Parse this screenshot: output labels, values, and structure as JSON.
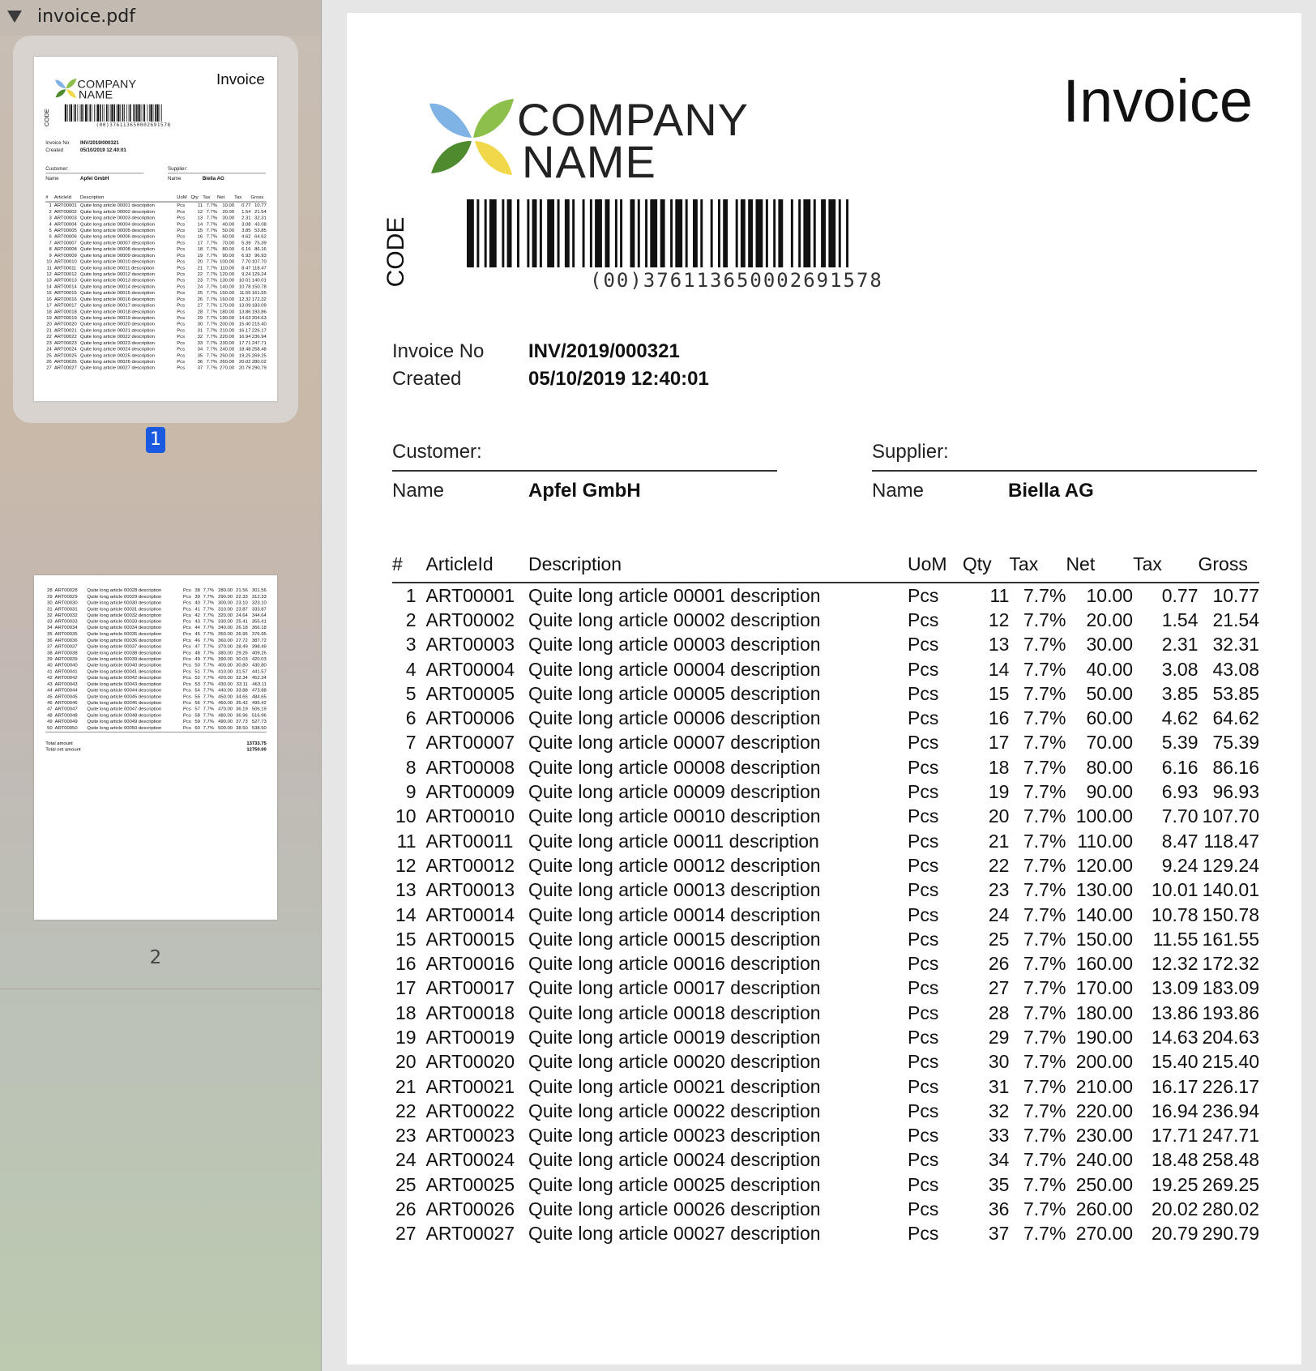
{
  "sidebar": {
    "file_name": "invoice.pdf",
    "pages": [
      {
        "number": "1",
        "selected": true
      },
      {
        "number": "2",
        "selected": false
      }
    ]
  },
  "invoice": {
    "company_line1": "COMPANY",
    "company_line2": "NAME",
    "title": "Invoice",
    "code_label": "CODE",
    "barcode_text": "(00)376113650002691578",
    "invoice_no_label": "Invoice No",
    "invoice_no": "INV/2019/000321",
    "created_label": "Created",
    "created": "05/10/2019 12:40:01",
    "customer_heading": "Customer:",
    "supplier_heading": "Supplier:",
    "name_label": "Name",
    "customer_name": "Apfel GmbH",
    "supplier_name": "Biella AG",
    "columns": [
      "#",
      "ArticleId",
      "Description",
      "UoM",
      "Qty",
      "Tax",
      "Net",
      "Tax",
      "Gross"
    ],
    "rows": [
      [
        "1",
        "ART00001",
        "Quite long article 00001 description",
        "Pcs",
        "11",
        "7.7%",
        "10.00",
        "0.77",
        "10.77"
      ],
      [
        "2",
        "ART00002",
        "Quite long article 00002 description",
        "Pcs",
        "12",
        "7.7%",
        "20.00",
        "1.54",
        "21.54"
      ],
      [
        "3",
        "ART00003",
        "Quite long article 00003 description",
        "Pcs",
        "13",
        "7.7%",
        "30.00",
        "2.31",
        "32.31"
      ],
      [
        "4",
        "ART00004",
        "Quite long article 00004 description",
        "Pcs",
        "14",
        "7.7%",
        "40.00",
        "3.08",
        "43.08"
      ],
      [
        "5",
        "ART00005",
        "Quite long article 00005 description",
        "Pcs",
        "15",
        "7.7%",
        "50.00",
        "3.85",
        "53.85"
      ],
      [
        "6",
        "ART00006",
        "Quite long article 00006 description",
        "Pcs",
        "16",
        "7.7%",
        "60.00",
        "4.62",
        "64.62"
      ],
      [
        "7",
        "ART00007",
        "Quite long article 00007 description",
        "Pcs",
        "17",
        "7.7%",
        "70.00",
        "5.39",
        "75.39"
      ],
      [
        "8",
        "ART00008",
        "Quite long article 00008 description",
        "Pcs",
        "18",
        "7.7%",
        "80.00",
        "6.16",
        "86.16"
      ],
      [
        "9",
        "ART00009",
        "Quite long article 00009 description",
        "Pcs",
        "19",
        "7.7%",
        "90.00",
        "6.93",
        "96.93"
      ],
      [
        "10",
        "ART00010",
        "Quite long article 00010 description",
        "Pcs",
        "20",
        "7.7%",
        "100.00",
        "7.70",
        "107.70"
      ],
      [
        "11",
        "ART00011",
        "Quite long article 00011 description",
        "Pcs",
        "21",
        "7.7%",
        "110.00",
        "8.47",
        "118.47"
      ],
      [
        "12",
        "ART00012",
        "Quite long article 00012 description",
        "Pcs",
        "22",
        "7.7%",
        "120.00",
        "9.24",
        "129.24"
      ],
      [
        "13",
        "ART00013",
        "Quite long article 00013 description",
        "Pcs",
        "23",
        "7.7%",
        "130.00",
        "10.01",
        "140.01"
      ],
      [
        "14",
        "ART00014",
        "Quite long article 00014 description",
        "Pcs",
        "24",
        "7.7%",
        "140.00",
        "10.78",
        "150.78"
      ],
      [
        "15",
        "ART00015",
        "Quite long article 00015 description",
        "Pcs",
        "25",
        "7.7%",
        "150.00",
        "11.55",
        "161.55"
      ],
      [
        "16",
        "ART00016",
        "Quite long article 00016 description",
        "Pcs",
        "26",
        "7.7%",
        "160.00",
        "12.32",
        "172.32"
      ],
      [
        "17",
        "ART00017",
        "Quite long article 00017 description",
        "Pcs",
        "27",
        "7.7%",
        "170.00",
        "13.09",
        "183.09"
      ],
      [
        "18",
        "ART00018",
        "Quite long article 00018 description",
        "Pcs",
        "28",
        "7.7%",
        "180.00",
        "13.86",
        "193.86"
      ],
      [
        "19",
        "ART00019",
        "Quite long article 00019 description",
        "Pcs",
        "29",
        "7.7%",
        "190.00",
        "14.63",
        "204.63"
      ],
      [
        "20",
        "ART00020",
        "Quite long article 00020 description",
        "Pcs",
        "30",
        "7.7%",
        "200.00",
        "15.40",
        "215.40"
      ],
      [
        "21",
        "ART00021",
        "Quite long article 00021 description",
        "Pcs",
        "31",
        "7.7%",
        "210.00",
        "16.17",
        "226.17"
      ],
      [
        "22",
        "ART00022",
        "Quite long article 00022 description",
        "Pcs",
        "32",
        "7.7%",
        "220.00",
        "16.94",
        "236.94"
      ],
      [
        "23",
        "ART00023",
        "Quite long article 00023 description",
        "Pcs",
        "33",
        "7.7%",
        "230.00",
        "17.71",
        "247.71"
      ],
      [
        "24",
        "ART00024",
        "Quite long article 00024 description",
        "Pcs",
        "34",
        "7.7%",
        "240.00",
        "18.48",
        "258.48"
      ],
      [
        "25",
        "ART00025",
        "Quite long article 00025 description",
        "Pcs",
        "35",
        "7.7%",
        "250.00",
        "19.25",
        "269.25"
      ],
      [
        "26",
        "ART00026",
        "Quite long article 00026 description",
        "Pcs",
        "36",
        "7.7%",
        "260.00",
        "20.02",
        "280.02"
      ],
      [
        "27",
        "ART00027",
        "Quite long article 00027 description",
        "Pcs",
        "37",
        "7.7%",
        "270.00",
        "20.79",
        "290.79"
      ]
    ],
    "page2_rows": [
      [
        "28",
        "ART00028",
        "Quite long article 00028 description",
        "Pcs",
        "38",
        "7.7%",
        "280.00",
        "21.56",
        "301.56"
      ],
      [
        "29",
        "ART00029",
        "Quite long article 00029 description",
        "Pcs",
        "39",
        "7.7%",
        "290.00",
        "22.33",
        "312.33"
      ],
      [
        "30",
        "ART00030",
        "Quite long article 00030 description",
        "Pcs",
        "40",
        "7.7%",
        "300.00",
        "23.10",
        "323.10"
      ],
      [
        "31",
        "ART00031",
        "Quite long article 00031 description",
        "Pcs",
        "41",
        "7.7%",
        "310.00",
        "23.87",
        "333.87"
      ],
      [
        "32",
        "ART00032",
        "Quite long article 00032 description",
        "Pcs",
        "42",
        "7.7%",
        "320.00",
        "24.64",
        "344.64"
      ],
      [
        "33",
        "ART00033",
        "Quite long article 00033 description",
        "Pcs",
        "43",
        "7.7%",
        "330.00",
        "25.41",
        "355.41"
      ],
      [
        "34",
        "ART00034",
        "Quite long article 00034 description",
        "Pcs",
        "44",
        "7.7%",
        "340.00",
        "26.18",
        "366.18"
      ],
      [
        "35",
        "ART00035",
        "Quite long article 00035 description",
        "Pcs",
        "45",
        "7.7%",
        "350.00",
        "26.95",
        "376.95"
      ],
      [
        "36",
        "ART00036",
        "Quite long article 00036 description",
        "Pcs",
        "46",
        "7.7%",
        "360.00",
        "27.72",
        "387.72"
      ],
      [
        "37",
        "ART00037",
        "Quite long article 00037 description",
        "Pcs",
        "47",
        "7.7%",
        "370.00",
        "28.49",
        "398.49"
      ],
      [
        "38",
        "ART00038",
        "Quite long article 00038 description",
        "Pcs",
        "48",
        "7.7%",
        "380.00",
        "29.26",
        "409.26"
      ],
      [
        "39",
        "ART00039",
        "Quite long article 00039 description",
        "Pcs",
        "49",
        "7.7%",
        "390.00",
        "30.03",
        "420.03"
      ],
      [
        "40",
        "ART00040",
        "Quite long article 00040 description",
        "Pcs",
        "50",
        "7.7%",
        "400.00",
        "30.80",
        "430.80"
      ],
      [
        "41",
        "ART00041",
        "Quite long article 00041 description",
        "Pcs",
        "51",
        "7.7%",
        "410.00",
        "31.57",
        "441.57"
      ],
      [
        "42",
        "ART00042",
        "Quite long article 00042 description",
        "Pcs",
        "52",
        "7.7%",
        "420.00",
        "32.34",
        "452.34"
      ],
      [
        "43",
        "ART00043",
        "Quite long article 00043 description",
        "Pcs",
        "53",
        "7.7%",
        "430.00",
        "33.11",
        "463.11"
      ],
      [
        "44",
        "ART00044",
        "Quite long article 00044 description",
        "Pcs",
        "54",
        "7.7%",
        "440.00",
        "33.88",
        "473.88"
      ],
      [
        "45",
        "ART00045",
        "Quite long article 00045 description",
        "Pcs",
        "55",
        "7.7%",
        "450.00",
        "34.65",
        "484.65"
      ],
      [
        "46",
        "ART00046",
        "Quite long article 00046 description",
        "Pcs",
        "56",
        "7.7%",
        "460.00",
        "35.42",
        "495.42"
      ],
      [
        "47",
        "ART00047",
        "Quite long article 00047 description",
        "Pcs",
        "57",
        "7.7%",
        "470.00",
        "36.19",
        "506.19"
      ],
      [
        "48",
        "ART00048",
        "Quite long article 00048 description",
        "Pcs",
        "58",
        "7.7%",
        "480.00",
        "36.96",
        "516.96"
      ],
      [
        "49",
        "ART00049",
        "Quite long article 00049 description",
        "Pcs",
        "59",
        "7.7%",
        "490.00",
        "37.73",
        "527.73"
      ],
      [
        "50",
        "ART00050",
        "Quite long article 00050 description",
        "Pcs",
        "60",
        "7.7%",
        "500.00",
        "38.50",
        "538.50"
      ]
    ],
    "total_amount_label": "Total amount",
    "total_amount": "13733.75",
    "total_net_label": "Total net amount",
    "total_net": "12750.00"
  },
  "colors": {
    "selection_badge": "#1a5ae0",
    "logo_blue": "#7fb2e5",
    "logo_green_light": "#8cc04a",
    "logo_green_dark": "#4e8a2e",
    "logo_yellow": "#f0d84a"
  },
  "icons": {
    "disclosure": "disclosure-triangle-icon",
    "logo": "leaf-logo-icon"
  }
}
